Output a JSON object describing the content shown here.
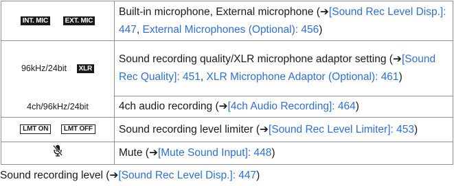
{
  "rows": {
    "mic": {
      "icon_left": "INT. MIC",
      "icon_right": "EXT. MIC",
      "text": "Built-in microphone, External microphone (",
      "link1": "[Sound Rec Level Disp.]: 447",
      "sep": ", ",
      "link2": "External Microphones (Optional): 456",
      "close": ")"
    },
    "quality": {
      "icon_text": "96kHz/24bit",
      "icon_badge": "XLR",
      "text": "Sound recording quality/XLR microphone adaptor setting (",
      "link1": "[Sound Rec Quality]: 451",
      "sep": ", ",
      "link2": "XLR Microphone Adaptor (Optional): 461",
      "close": ")"
    },
    "fourch": {
      "icon_text": "4ch/96kHz/24bit",
      "text": "4ch audio recording (",
      "link1": "[4ch Audio Recording]: 464",
      "close": ")"
    },
    "limiter": {
      "icon_left": "LMT ON",
      "icon_right": "LMT OFF",
      "text": "Sound recording level limiter (",
      "link1": "[Sound Rec Level Limiter]: 453",
      "close": ")"
    },
    "mute": {
      "icon_name": "mute-microphone-icon",
      "text": "Mute (",
      "link1": "[Mute Sound Input]: 448",
      "close": ")"
    }
  },
  "arrow_glyph": "➔",
  "footer": {
    "text": "Sound recording level (",
    "link1": "[Sound Rec Level Disp.]: 447",
    "close": ")"
  },
  "colors": {
    "link": "#2e6fd8",
    "border": "#8f8f8f",
    "text": "#1a1a1a"
  }
}
